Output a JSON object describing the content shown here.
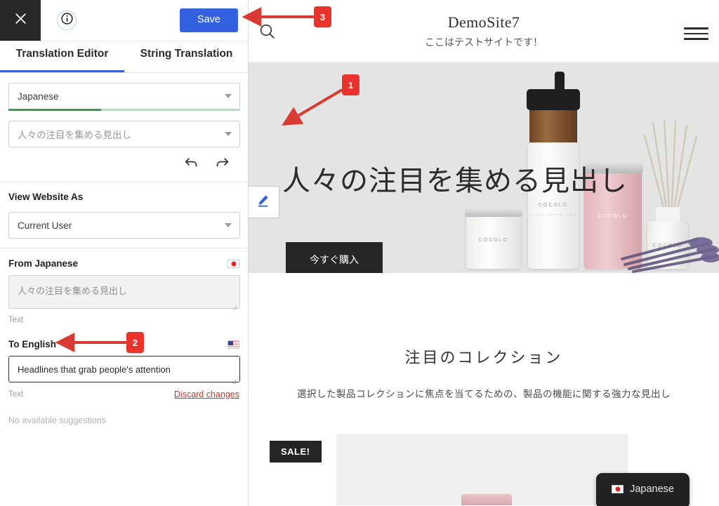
{
  "panel": {
    "close_icon": "close-icon",
    "info_icon": "info-circle-icon",
    "save_label": "Save",
    "tabs": [
      {
        "label": "Translation Editor",
        "active": true
      },
      {
        "label": "String Translation",
        "active": false
      }
    ],
    "language_select": {
      "value": "Japanese",
      "progress_percent": 40
    },
    "string_select": {
      "placeholder": "人々の注目を集める見出し"
    },
    "undo_icon": "undo-arrow-icon",
    "redo_icon": "redo-arrow-icon",
    "view_website_as": {
      "heading": "View Website As",
      "value": "Current User"
    },
    "source": {
      "heading": "From Japanese",
      "flag": "flag-japan-icon",
      "value": "人々の注目を集める見出し",
      "type_label": "Text"
    },
    "target": {
      "heading": "To English",
      "flag": "flag-usa-icon",
      "value": "Headlines that grab people's attention",
      "type_label": "Text",
      "discard_label": "Discard changes",
      "suggestions_label": "No available suggestions"
    }
  },
  "site": {
    "search_icon": "search-icon",
    "title": "DemoSite7",
    "subtitle": "ここはテストサイトです！",
    "menu_icon": "hamburger-menu-icon",
    "hero": {
      "headline": "人々の注目を集める見出し",
      "edit_icon": "pencil-edit-icon",
      "cta_label": "今すぐ購入",
      "product_brand": "COCOLO"
    },
    "featured": {
      "heading": "注目のコレクション",
      "paragraph": "選択した製品コレクションに焦点を当てるための、製品の機能に関する強力な見出し",
      "sale_badge": "SALE!"
    },
    "language_badge": {
      "label": "Japanese",
      "flag": "flag-japan-icon"
    }
  },
  "annotations": [
    {
      "number": "1"
    },
    {
      "number": "2"
    },
    {
      "number": "3"
    }
  ],
  "colors": {
    "accent_blue": "#3461e0",
    "tab_underline": "#3b5fdc",
    "annotation_red": "#e8342c",
    "progress_green": "#3f9b48",
    "discard_red": "#c0392b"
  }
}
